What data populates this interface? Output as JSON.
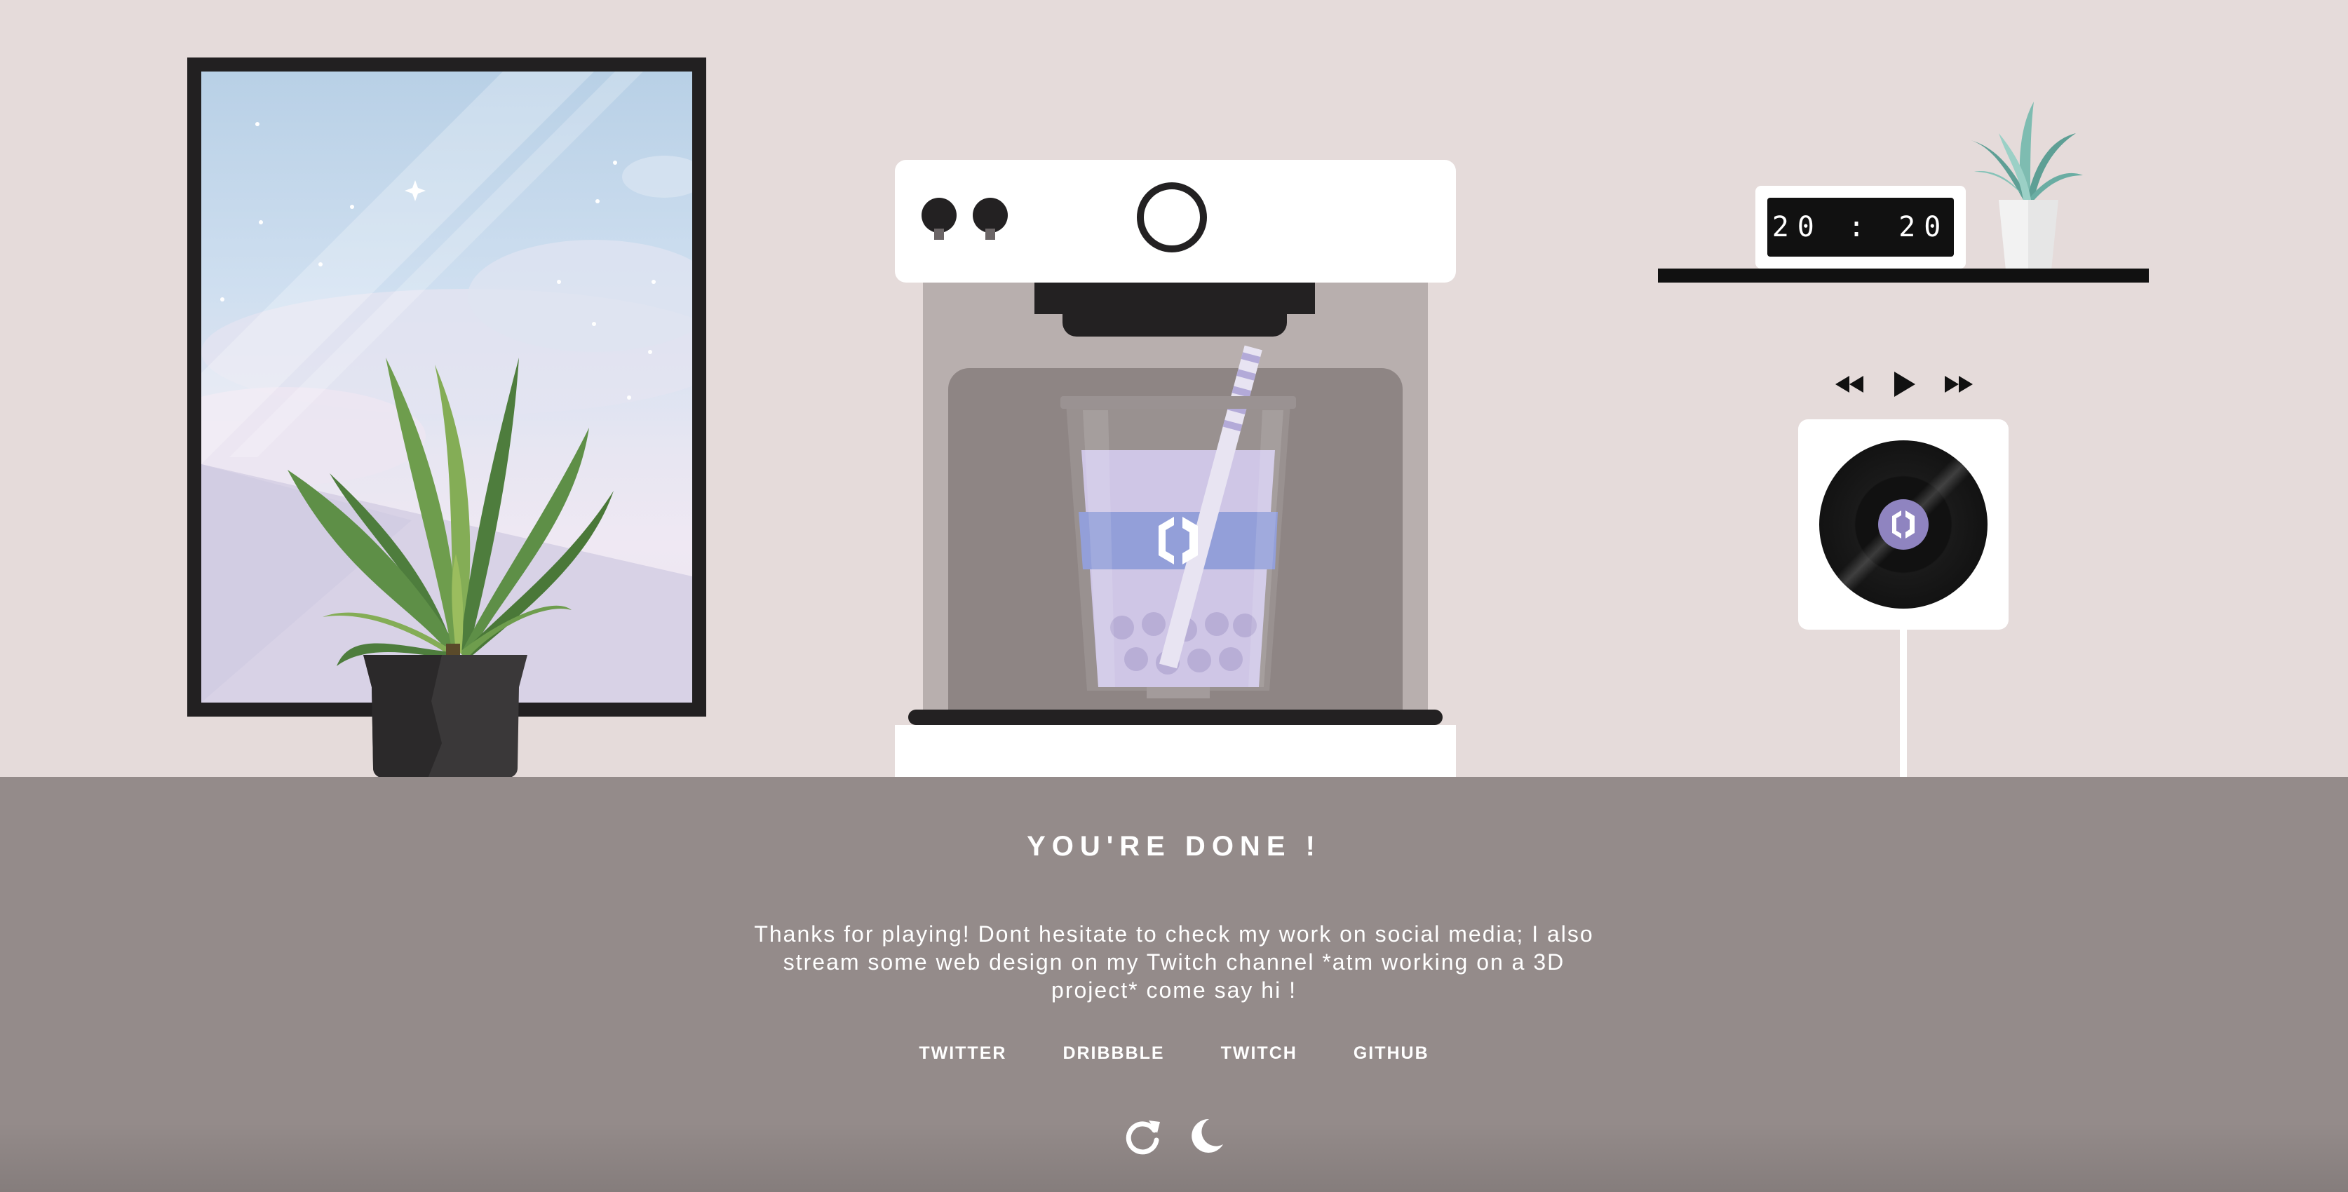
{
  "clock": {
    "hours": "20",
    "separator": ":",
    "minutes": "20",
    "display": "20 : 20"
  },
  "player": {
    "prev_icon": "rewind-icon",
    "play_icon": "play-icon",
    "next_icon": "fast-forward-icon"
  },
  "end_screen": {
    "title": "YOU'RE DONE !",
    "message": "Thanks for playing! Dont hesitate to check my work on social media; I also stream some web design on my Twitch channel *atm working on a 3D project* come say hi !",
    "links": [
      {
        "label": "TWITTER"
      },
      {
        "label": "DRIBBBLE"
      },
      {
        "label": "TWITCH"
      },
      {
        "label": "GITHUB"
      }
    ],
    "actions": {
      "replay_icon": "replay-icon",
      "theme_icon": "moon-icon"
    }
  },
  "colors": {
    "wall": "#e5dbda",
    "panel": "#948b8a",
    "dark": "#232122",
    "accent_purple": "#8f84c0",
    "cup_band": "#939fd9"
  }
}
